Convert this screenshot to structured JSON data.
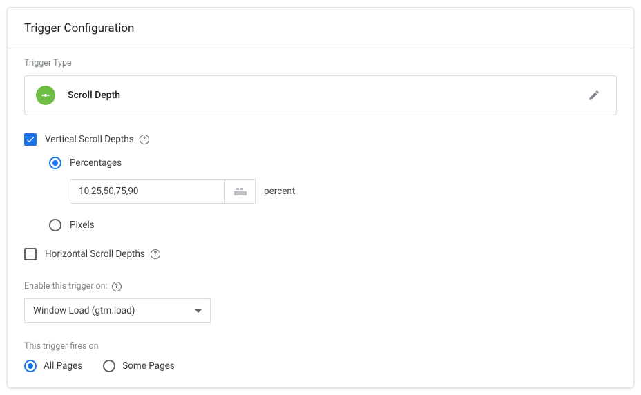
{
  "header": {
    "title": "Trigger Configuration"
  },
  "triggerType": {
    "label": "Trigger Type",
    "name": "Scroll Depth"
  },
  "verticalScroll": {
    "checkboxLabel": "Vertical Scroll Depths",
    "checked": true,
    "percentages": {
      "label": "Percentages",
      "selected": true,
      "value": "10,25,50,75,90",
      "unit": "percent"
    },
    "pixels": {
      "label": "Pixels",
      "selected": false
    }
  },
  "horizontalScroll": {
    "checkboxLabel": "Horizontal Scroll Depths",
    "checked": false
  },
  "enableOn": {
    "label": "Enable this trigger on:",
    "selected": "Window Load (gtm.load)"
  },
  "firesOn": {
    "label": "This trigger fires on",
    "options": {
      "allPages": {
        "label": "All Pages",
        "selected": true
      },
      "somePages": {
        "label": "Some Pages",
        "selected": false
      }
    }
  }
}
